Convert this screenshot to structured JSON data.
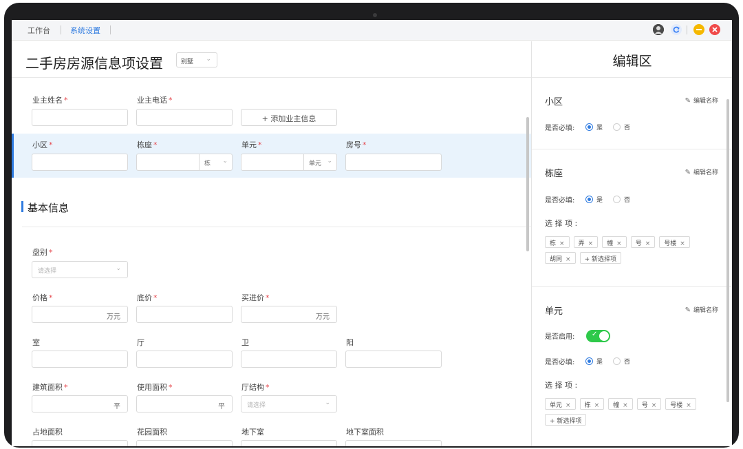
{
  "topbar": {
    "tabs": [
      "工作台",
      "系统设置"
    ],
    "icons": [
      "avatar-icon",
      "refresh-icon",
      "minimize-icon",
      "close-icon"
    ],
    "colors": {
      "refresh": "#3b82f6",
      "minimize": "#f5b800",
      "close": "#f04a4a"
    }
  },
  "main": {
    "title": "二手房房源信息项设置",
    "type_select": "别墅",
    "owner": {
      "name_label": "业主姓名",
      "phone_label": "业主电话",
      "add_button": "+ 添加业主信息"
    },
    "address": {
      "community_label": "小区",
      "building_label": "栋座",
      "building_unit": "栋",
      "unit_label": "单元",
      "unit_unit": "单元",
      "room_label": "房号"
    },
    "section_title": "基本信息",
    "fields": {
      "pan_label": "盘别",
      "pan_placeholder": "请选择",
      "price_label": "价格",
      "price_unit": "万元",
      "floor_price_label": "底价",
      "buy_price_label": "买进价",
      "buy_price_unit": "万元",
      "room_label": "室",
      "hall_label": "厅",
      "bath_label": "卫",
      "balcony_label": "阳",
      "build_area_label": "建筑面积",
      "build_area_unit": "平",
      "use_area_label": "使用面积",
      "use_area_unit": "平",
      "hall_struct_label": "厅结构",
      "hall_struct_placeholder": "请选择",
      "land_area_label": "占地面积",
      "garden_area_label": "花园面积",
      "basement_label": "地下室",
      "basement_area_label": "地下室面积"
    }
  },
  "editor": {
    "title": "编辑区",
    "edit_name": "编辑名称",
    "required_label": "是否必填:",
    "enabled_label": "是否启用:",
    "options_label": "选 择 项 :",
    "yes": "是",
    "no": "否",
    "new_option": "+ 新选择项",
    "items": [
      {
        "name": "小区"
      },
      {
        "name": "栋座",
        "options": [
          "栋",
          "弄",
          "幢",
          "号",
          "号楼",
          "胡同"
        ]
      },
      {
        "name": "单元",
        "enabled": true,
        "options": [
          "单元",
          "栋",
          "幢",
          "号",
          "号楼"
        ]
      }
    ]
  }
}
